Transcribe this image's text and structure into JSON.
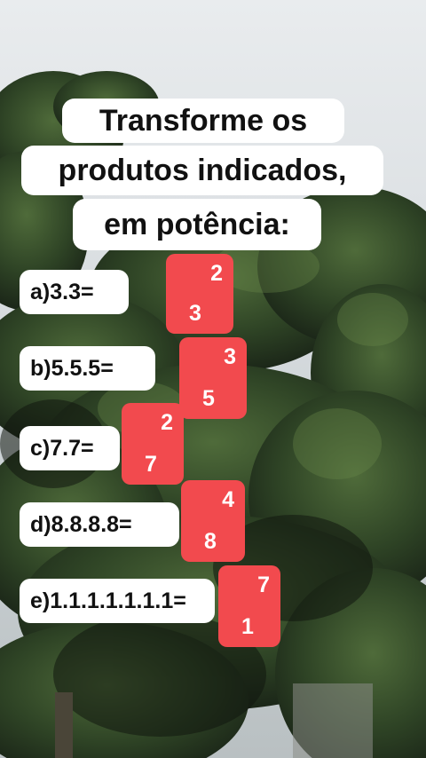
{
  "title": {
    "line1": "Transforme os",
    "line2": "produtos indicados,",
    "line3": "em potência:"
  },
  "questions": [
    {
      "label": "a)3.3=",
      "exponent": "2",
      "base": "3"
    },
    {
      "label": "b)5.5.5=",
      "exponent": "3",
      "base": "5"
    },
    {
      "label": "c)7.7=",
      "exponent": "2",
      "base": "7"
    },
    {
      "label": "d)8.8.8.8=",
      "exponent": "4",
      "base": "8"
    },
    {
      "label": "e)1.1.1.1.1.1.1=",
      "exponent": "7",
      "base": "1"
    }
  ],
  "colors": {
    "answer_box": "#f24a4e",
    "foliage_dark": "#1f2a1c",
    "foliage_mid": "#3d5a2e"
  }
}
